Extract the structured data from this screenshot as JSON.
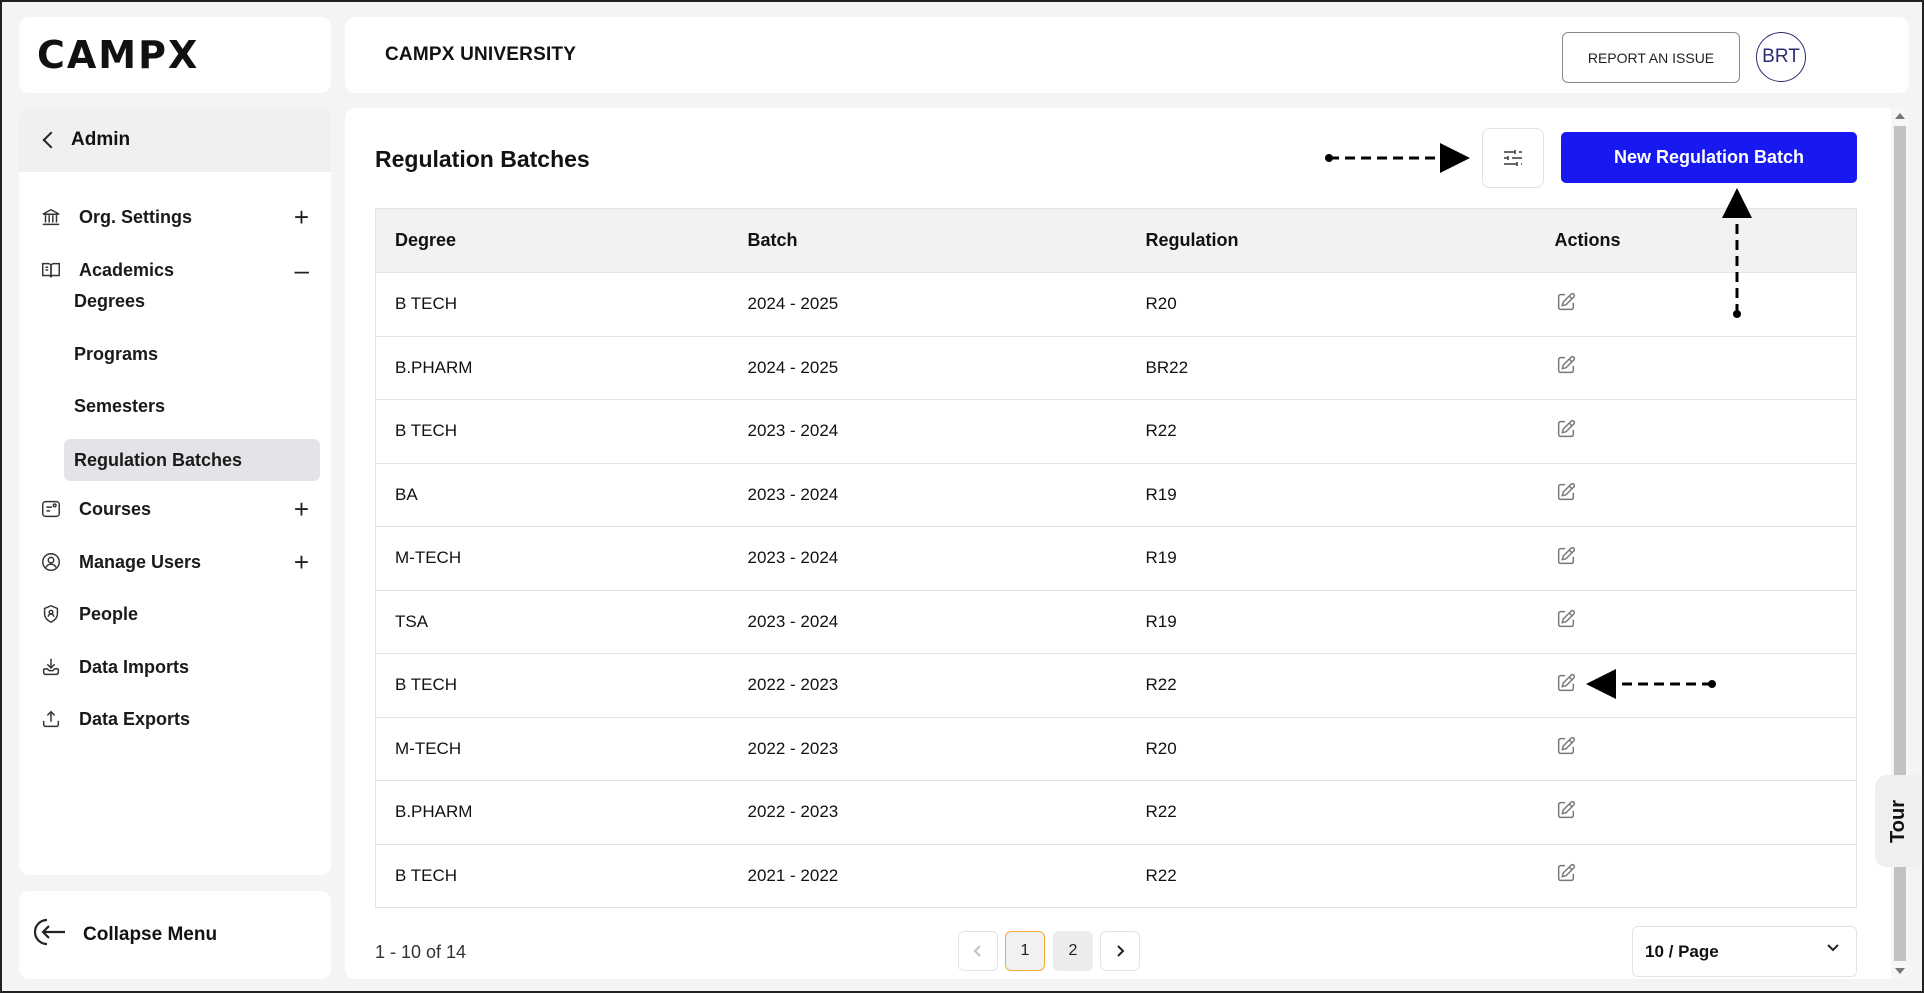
{
  "brand": {
    "logo": "CAMPX"
  },
  "header": {
    "org_name": "CAMPX UNIVERSITY",
    "report_label": "REPORT AN ISSUE",
    "avatar_initials": "BRT"
  },
  "sidebar": {
    "back_label": "Admin",
    "items": [
      {
        "label": "Org. Settings",
        "icon": "bank-icon",
        "toggle": "+"
      },
      {
        "label": "Academics",
        "icon": "book-icon",
        "toggle": "–"
      },
      {
        "label": "Courses",
        "icon": "course-icon",
        "toggle": "+"
      },
      {
        "label": "Manage Users",
        "icon": "user-circle-icon",
        "toggle": "+"
      },
      {
        "label": "People",
        "icon": "shield-user-icon"
      },
      {
        "label": "Data Imports",
        "icon": "import-icon"
      },
      {
        "label": "Data Exports",
        "icon": "export-icon"
      }
    ],
    "academics_sub": [
      "Degrees",
      "Programs",
      "Semesters",
      "Regulation Batches"
    ],
    "active_sub": "Regulation Batches",
    "collapse_label": "Collapse Menu"
  },
  "main": {
    "title": "Regulation Batches",
    "new_button": "New Regulation Batch",
    "columns": [
      "Degree",
      "Batch",
      "Regulation",
      "Actions"
    ],
    "rows": [
      [
        "B TECH",
        "2024 - 2025",
        "R20"
      ],
      [
        "B.PHARM",
        "2024 - 2025",
        "BR22"
      ],
      [
        "B TECH",
        "2023 - 2024",
        "R22"
      ],
      [
        "BA",
        "2023 - 2024",
        "R19"
      ],
      [
        "M-TECH",
        "2023 - 2024",
        "R19"
      ],
      [
        "TSA",
        "2023 - 2024",
        "R19"
      ],
      [
        "B TECH",
        "2022 - 2023",
        "R22"
      ],
      [
        "M-TECH",
        "2022 - 2023",
        "R20"
      ],
      [
        "B.PHARM",
        "2022 - 2023",
        "R22"
      ],
      [
        "B TECH",
        "2021 - 2022",
        "R22"
      ]
    ],
    "pagination": {
      "info": "1 - 10 of 14",
      "pages": [
        "1",
        "2"
      ],
      "current": "1",
      "page_size": "10 / Page"
    }
  },
  "tour_label": "Tour",
  "colors": {
    "primary": "#1818f0",
    "active_page_border": "#f0a83a"
  }
}
